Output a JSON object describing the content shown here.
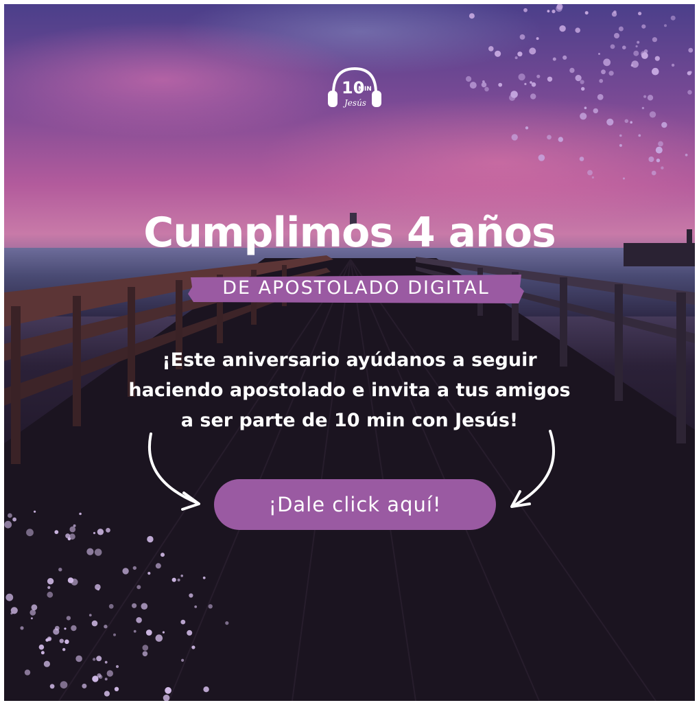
{
  "poster": {
    "title": "Cumplimos 4 años",
    "subtitle": "DE APOSTOLADO DIGITAL",
    "body_lines": [
      "¡Este aniversario ayúdanos a seguir",
      "haciendo apostolado e invita a tus amigos",
      "a ser parte de 10 min con Jesús!"
    ],
    "cta_label": "¡Dale click aquí!"
  },
  "logo": {
    "number": "10",
    "word": "MIN",
    "script": "Jesús",
    "icon": "headphones-icon"
  },
  "colors": {
    "accent": "#9a5aa2",
    "text": "#ffffff",
    "confetti": "#c6a8e0"
  }
}
